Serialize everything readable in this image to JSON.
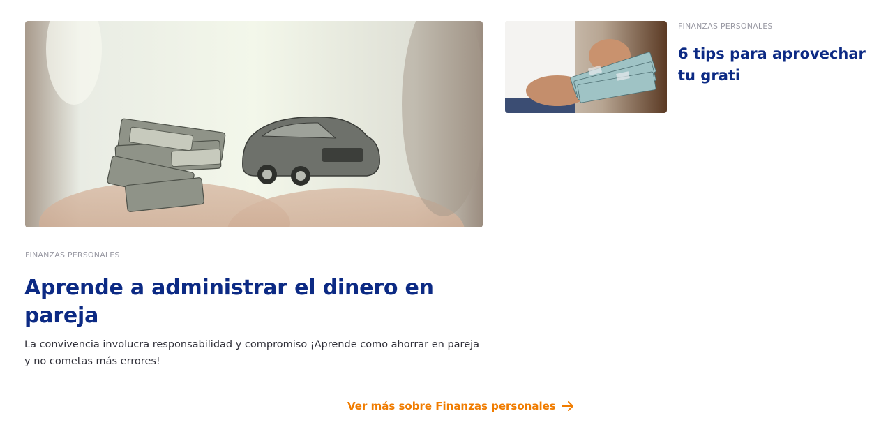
{
  "featured": {
    "category": "FINANZAS PERSONALES",
    "title": "Aprende a administrar el dinero en pareja",
    "excerpt": "La convivencia involucra responsabilidad y compromiso ¡Aprende como ahorrar en pareja y no cometas más errores!",
    "image_icon": "car-and-money-illustration"
  },
  "side_article": {
    "category": "FINANZAS PERSONALES",
    "title": "6 tips para aprovechar tu grati",
    "image_icon": "hands-counting-money-photo"
  },
  "more_link": {
    "label": "Ver más sobre Finanzas personales",
    "icon": "arrow-right-icon"
  },
  "colors": {
    "title": "#0c2a84",
    "category": "#9a9aa4",
    "link": "#f07c00",
    "text": "#2f2f38"
  }
}
